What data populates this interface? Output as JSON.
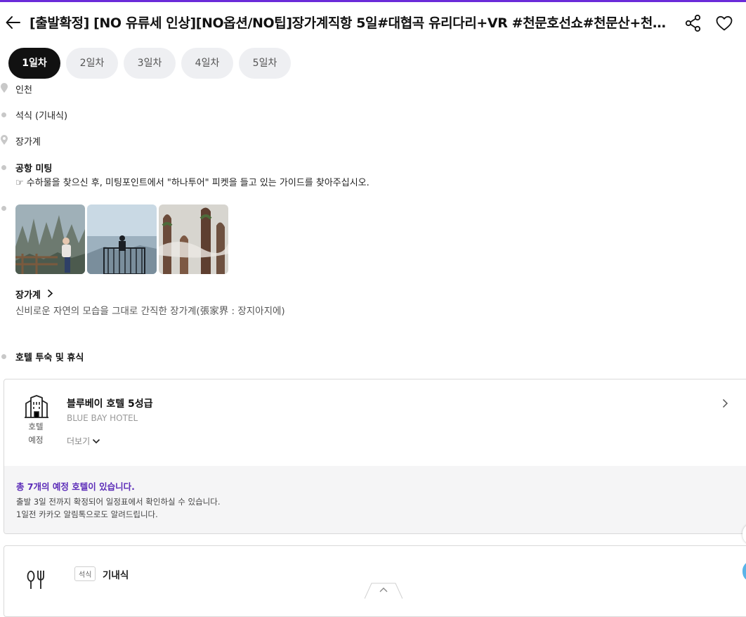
{
  "header": {
    "title": "[출발확정] [NO 유류세 인상][NO옵션/NO팁]장가계직항 5일#대협곡 유리다리+VR #천문호선쇼#천문산+천문산사…"
  },
  "tabs": [
    {
      "label": "1일차",
      "active": true
    },
    {
      "label": "2일차",
      "active": false
    },
    {
      "label": "3일차",
      "active": false
    },
    {
      "label": "4일차",
      "active": false
    },
    {
      "label": "5일차",
      "active": false
    }
  ],
  "timeline": {
    "depart": "인천",
    "meal": "석식 (기내식)",
    "arrive": "장가계",
    "meeting_title": "공항 미팅",
    "meeting_desc": "☞ 수하물을 찾으신 후, 미팅포인트에서 \"하나투어\" 피켓을 들고 있는 가이드를 찾아주십시오.",
    "place_title": "장가계",
    "place_desc": "신비로운 자연의 모습을 그대로 간직한 장가계(張家界 : 장지아지에)",
    "hotel_step": "호텔 투숙 및 휴식"
  },
  "hotel_card": {
    "icon_label_1": "호텔",
    "icon_label_2": "예정",
    "name": "블루베이 호텔 5성급",
    "name_en": "BLUE BAY HOTEL",
    "more": "더보기",
    "notice_title": "총 7개의 예정 호텔이 있습니다.",
    "notice_line1": "출발 3일 전까지 확정되어 일정표에서 확인하실 수 있습니다.",
    "notice_line2": "1일전 카카오 알림톡으로도 알려드립니다."
  },
  "meal_card": {
    "chip": "석식",
    "meal": "기내식"
  },
  "colors": {
    "accent": "#6a2bd9",
    "notice": "#5b2bb8",
    "tab_active": "#111111",
    "tab_inactive": "#eeeff2"
  }
}
